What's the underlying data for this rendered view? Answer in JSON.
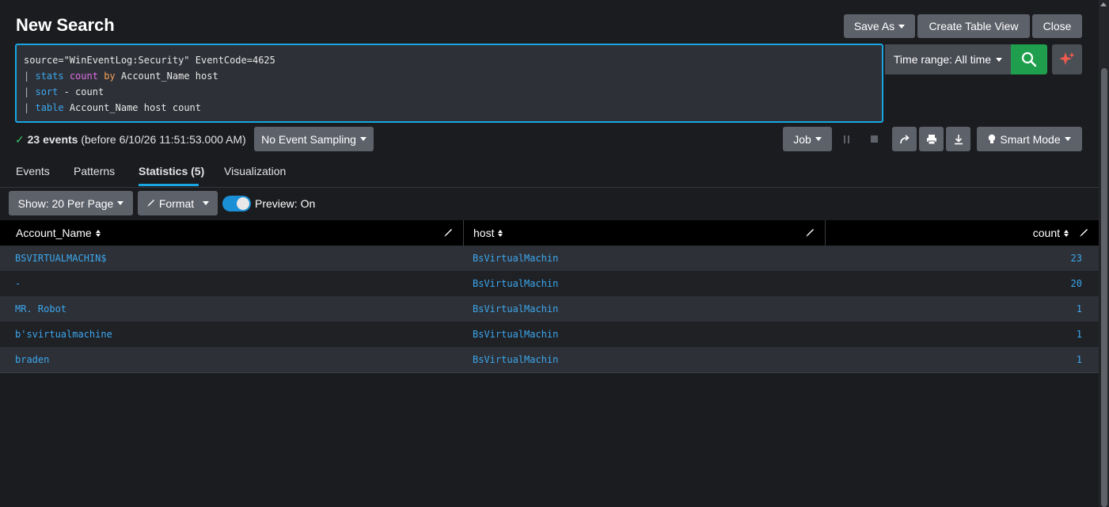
{
  "header": {
    "title": "New Search",
    "save_as": "Save As",
    "create_table_view": "Create Table View",
    "close": "Close"
  },
  "query": {
    "line1": "source=\"WinEventLog:Security\" EventCode=4625",
    "line2": {
      "pipe": "|",
      "cmd": "stats",
      "fn": "count",
      "by": "by",
      "rest": "Account_Name host"
    },
    "line3": {
      "pipe": "|",
      "cmd": "sort",
      "rest": "- count"
    },
    "line4": {
      "pipe": "|",
      "cmd": "table",
      "rest": "Account_Name host count"
    }
  },
  "time_range": {
    "label": "Time range: All time"
  },
  "status": {
    "check": "✓",
    "events": "23 events",
    "detail": "(before 6/10/26 11:51:53.000 AM)",
    "sampling": "No Event Sampling"
  },
  "job_controls": {
    "job": "Job",
    "smart_mode": "Smart Mode"
  },
  "tabs": [
    "Events",
    "Patterns",
    "Statistics (5)",
    "Visualization"
  ],
  "table_controls": {
    "show": "Show: 20 Per Page",
    "format": "Format",
    "preview": "Preview: On"
  },
  "table": {
    "columns": [
      "Account_Name",
      "host",
      "count"
    ],
    "rows": [
      [
        "BSVIRTUALMACHIN$",
        "BsVirtualMachin",
        "23"
      ],
      [
        "-",
        "BsVirtualMachin",
        "20"
      ],
      [
        "MR. Robot",
        "BsVirtualMachin",
        "1"
      ],
      [
        "b'svirtualmachine",
        "BsVirtualMachin",
        "1"
      ],
      [
        "braden",
        "BsVirtualMachin",
        "1"
      ]
    ]
  },
  "colors": {
    "accent": "#1aa6e2",
    "search_button": "#1f9f4d",
    "link": "#3da7ee",
    "background": "#1b1c1f"
  }
}
